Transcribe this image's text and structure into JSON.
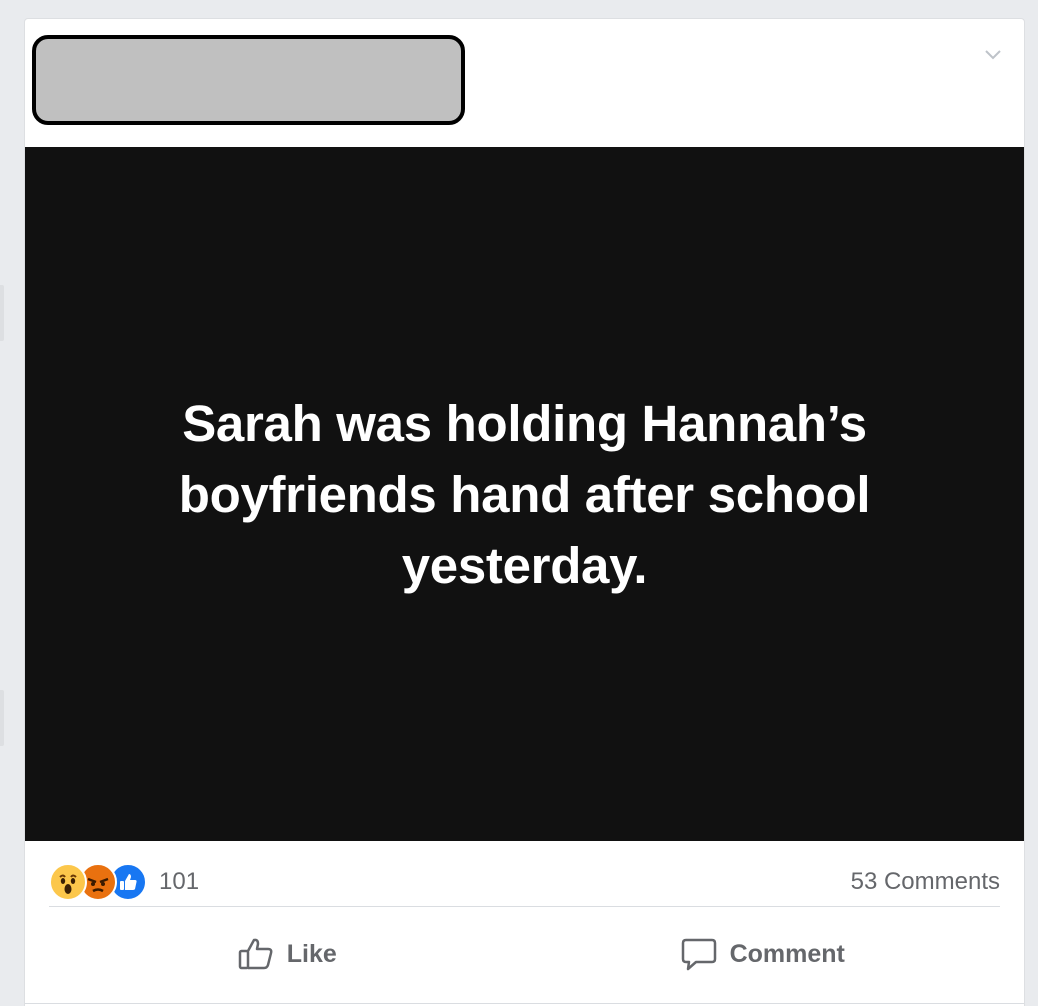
{
  "post": {
    "author_redacted": true,
    "menu_icon": "chevron-down-icon",
    "image_text": "Sarah was holding Hannah’s boyfriends hand after school yesterday.",
    "reactions": {
      "icons": [
        "wow-reaction-icon",
        "angry-reaction-icon",
        "like-reaction-icon"
      ],
      "count": "101"
    },
    "comments_count": "53 Comments",
    "actions": {
      "like_label": "Like",
      "comment_label": "Comment"
    }
  },
  "colors": {
    "page_background": "#e9ebee",
    "image_background": "#111111",
    "like_blue": "#1877f2",
    "wow_yellow": "#fcc74b",
    "angry_orange": "#e9710f",
    "secondary_text": "#65676b"
  }
}
